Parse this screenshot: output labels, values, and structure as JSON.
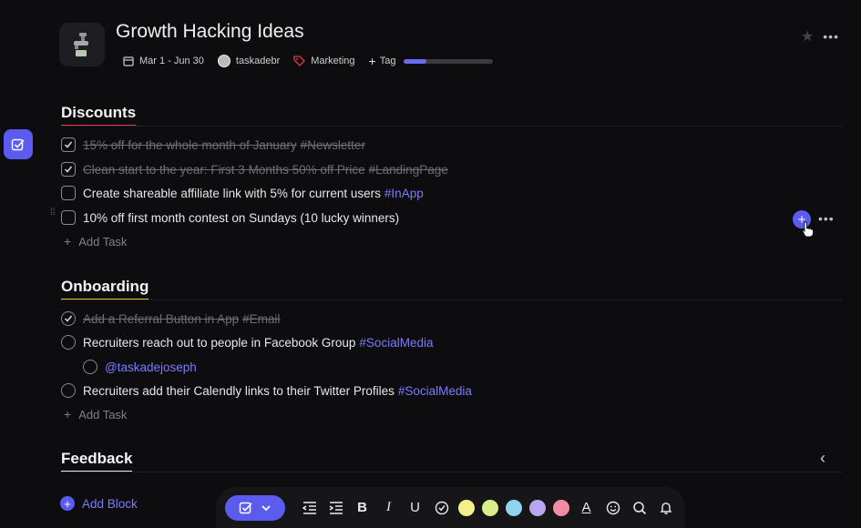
{
  "header": {
    "title": "Growth Hacking Ideas",
    "date_range": "Mar 1 - Jun 30",
    "owner": "taskadebr",
    "tag_label": "Marketing",
    "add_tag_label": "Tag",
    "progress": 0.25
  },
  "sections": [
    {
      "title": "Discounts",
      "underline_color": "#e8344e",
      "tasks": [
        {
          "text": "15% off for the whole month of January",
          "tag": "#Newsletter",
          "done": true
        },
        {
          "text": "Clean start to the year: First 3 Months 50% off Price",
          "tag": "#LandingPage",
          "done": true
        },
        {
          "text": "Create shareable affiliate link with 5%  for current users",
          "tag": "#InApp",
          "done": false
        },
        {
          "text": "10% off first month contest on Sundays (10 lucky winners)",
          "tag": "",
          "done": false
        }
      ],
      "add_task_label": "Add Task"
    },
    {
      "title": "Onboarding",
      "underline_color": "#e8c834",
      "tasks": [
        {
          "text": "Add a Referral Button in App",
          "tag": "#Email",
          "done": true
        },
        {
          "text": "Recruiters reach out to people in Facebook Group",
          "tag": "#SocialMedia",
          "done": false
        },
        {
          "text": "",
          "mention": "@taskadejoseph",
          "done": false
        },
        {
          "text": "Recruiters add their Calendly links to their Twitter Profiles",
          "tag": "#SocialMedia",
          "done": false
        }
      ],
      "add_task_label": "Add Task"
    },
    {
      "title": "Feedback",
      "underline_color": "#e8e8e8"
    }
  ],
  "add_block_label": "Add Block",
  "toolbar": {
    "bold": "B",
    "italic": "I",
    "underline": "U",
    "text_color": "A",
    "swatches": [
      "#f3f08a",
      "#d9ef8c",
      "#8fd3f0",
      "#b9a6ef",
      "#f28ca2"
    ]
  },
  "colors": {
    "accent": "#5b5bf0",
    "background": "#0d0d0f",
    "tag": "#7b7bff"
  }
}
